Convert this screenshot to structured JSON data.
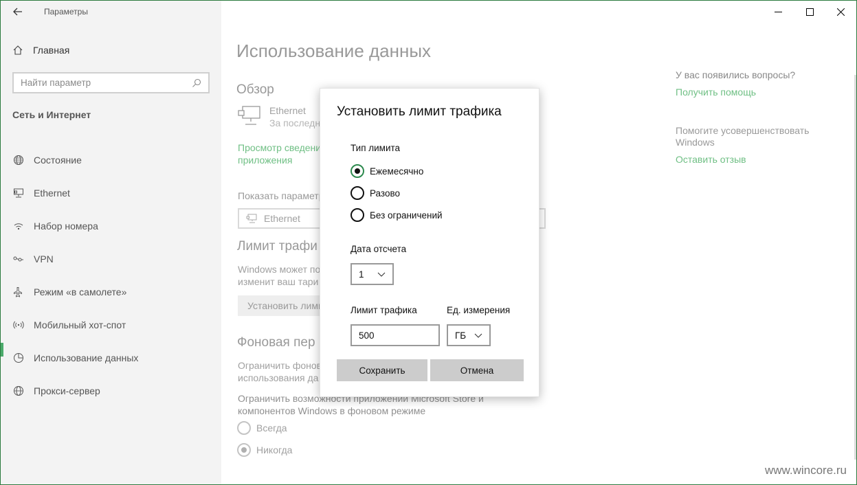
{
  "window": {
    "app_title": "Параметры",
    "controls": {
      "minimize": "—",
      "maximize": "☐",
      "close": "✕"
    }
  },
  "sidebar": {
    "home_label": "Главная",
    "search_placeholder": "Найти параметр",
    "section_heading": "Сеть и Интернет",
    "items": [
      {
        "label": "Состояние",
        "icon": "globe-icon",
        "active": false
      },
      {
        "label": "Ethernet",
        "icon": "ethernet-icon",
        "active": false
      },
      {
        "label": "Набор номера",
        "icon": "dialup-icon",
        "active": false
      },
      {
        "label": "VPN",
        "icon": "vpn-icon",
        "active": false
      },
      {
        "label": "Режим «в самолете»",
        "icon": "airplane-icon",
        "active": false
      },
      {
        "label": "Мобильный хот-спот",
        "icon": "hotspot-icon",
        "active": false
      },
      {
        "label": "Использование данных",
        "icon": "data-usage-icon",
        "active": true
      },
      {
        "label": "Прокси-сервер",
        "icon": "globe-icon",
        "active": false
      }
    ],
    "accent_color": "#4aaa6a"
  },
  "main": {
    "title": "Использование данных",
    "overview_heading": "Обзор",
    "ethernet_name": "Ethernet",
    "ethernet_sub": "За последн",
    "view_link_line1": "Просмотр сведени",
    "view_link_line2": "приложения",
    "show_params_label": "Показать параметр",
    "select_value": "Ethernet",
    "limit_heading": "Лимит трафи",
    "limit_desc_line1": "Windows может по",
    "limit_desc_line2": "изменит ваш тари",
    "set_limit_button": "Установить лими",
    "background_heading": "Фоновая пер",
    "bg_desc_line1": "Ограничить фонов",
    "bg_desc_line2": "использования да",
    "restrict_line1": "Ограничить возможности приложений Microsoft Store и",
    "restrict_line2": "компонентов Windows в фоновом режиме",
    "bg_options": [
      {
        "label": "Всегда",
        "selected": false
      },
      {
        "label": "Никогда",
        "selected": true
      }
    ]
  },
  "right": {
    "questions": "У вас появились вопросы?",
    "help_link": "Получить помощь",
    "improve_line1": "Помогите усовершенствовать",
    "improve_line2": "Windows",
    "feedback_link": "Оставить отзыв"
  },
  "dialog": {
    "title": "Установить лимит трафика",
    "limit_type_label": "Тип лимита",
    "limit_types": [
      {
        "label": "Ежемесячно",
        "selected": true
      },
      {
        "label": "Разово",
        "selected": false
      },
      {
        "label": "Без ограничений",
        "selected": false
      }
    ],
    "start_date_label": "Дата отсчета",
    "start_date_value": "1",
    "traffic_limit_label": "Лимит трафика",
    "traffic_limit_value": "500",
    "unit_label": "Ед. измерения",
    "unit_value": "ГБ",
    "save_button": "Сохранить",
    "cancel_button": "Отмена"
  },
  "watermark": "www.wincore.ru"
}
